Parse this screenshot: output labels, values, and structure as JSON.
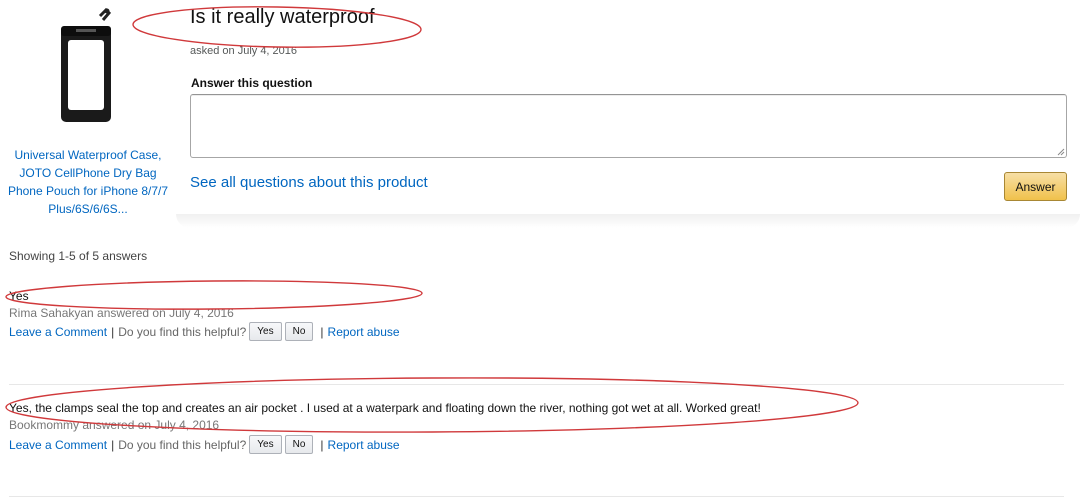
{
  "product": {
    "title": "Universal Waterproof Case, JOTO CellPhone Dry Bag Phone Pouch for iPhone 8/7/7 Plus/6S/6/6S...",
    "image_icon": "phone-pouch-image"
  },
  "question": {
    "title": "Is it really waterproof",
    "asked": "asked on July 4, 2016"
  },
  "answer_form": {
    "label": "Answer this question",
    "input_value": "",
    "see_all_label": "See all questions about this product",
    "submit_label": "Answer"
  },
  "answers_summary": "Showing 1-5 of 5 answers",
  "answers": [
    {
      "text": "Yes",
      "meta": "Rima Sahakyan answered on July 4, 2016",
      "leave_comment": "Leave a Comment",
      "helpful_q": "Do you find this helpful?",
      "yes_label": "Yes",
      "no_label": "No",
      "report": "Report abuse"
    },
    {
      "text": "Yes, the clamps seal the top and creates an air pocket . I used at a waterpark and floating down the river, nothing got wet at all. Worked great!",
      "meta": "Bookmommy answered on July 4, 2016",
      "leave_comment": "Leave a Comment",
      "helpful_q": "Do you find this helpful?",
      "yes_label": "Yes",
      "no_label": "No",
      "report": "Report abuse"
    }
  ],
  "colors": {
    "link": "#0066c0",
    "answer_button": "#f0c14b",
    "annotation": "#d0393b"
  }
}
